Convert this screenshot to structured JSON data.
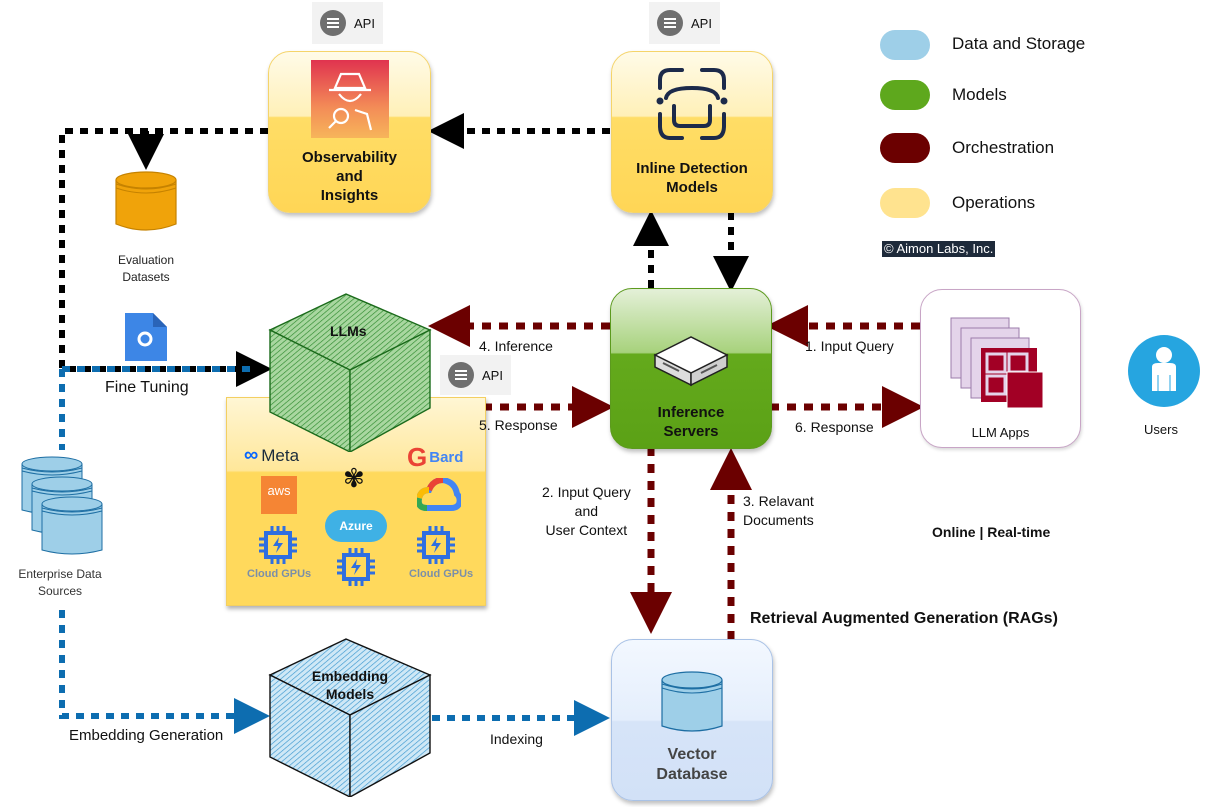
{
  "legend": {
    "items": [
      {
        "label": "Data and Storage",
        "color": "#9ecfe8"
      },
      {
        "label": "Models",
        "color": "#5ea81d"
      },
      {
        "label": "Orchestration",
        "color": "#6b0000"
      },
      {
        "label": "Operations",
        "color": "#ffe38f"
      }
    ],
    "copyright": "© Aimon Labs, Inc."
  },
  "nodes": {
    "observability": {
      "label_lines": [
        "Observability",
        "and",
        "Insights"
      ],
      "api_label": "API"
    },
    "inline_detection": {
      "label_lines": [
        "Inline Detection",
        "Models"
      ],
      "api_label": "API"
    },
    "evaluation_datasets": {
      "label_lines": [
        "Evaluation",
        "Datasets"
      ]
    },
    "llms": {
      "label": "LLMs",
      "api_label": "API"
    },
    "inference_servers": {
      "label_lines": [
        "Inference",
        "Servers"
      ]
    },
    "llm_apps": {
      "label": "LLM Apps"
    },
    "users": {
      "label": "Users"
    },
    "enterprise_data": {
      "label_lines": [
        "Enterprise Data",
        "Sources"
      ]
    },
    "embedding_models": {
      "label_lines": [
        "Embedding",
        "Models"
      ]
    },
    "vector_database": {
      "label_lines": [
        "Vector",
        "Database"
      ]
    }
  },
  "providers": {
    "meta": "Meta",
    "aws": "aws",
    "bard": "Bard",
    "azure": "Azure",
    "gpu_label": "Cloud GPUs"
  },
  "edges": {
    "fine_tuning": "Fine Tuning",
    "inference": "4. Inference",
    "response5": "5. Response",
    "input_query": "1. Input Query",
    "response6": "6. Response",
    "rag_query_lines": [
      "2. Input Query",
      "and",
      "User Context"
    ],
    "relevant_docs_lines": [
      "3. Relavant",
      "Documents"
    ],
    "embedding_generation": "Embedding Generation",
    "indexing": "Indexing"
  },
  "annotations": {
    "online": "Online | Real-time",
    "rag": "Retrieval Augmented Generation (RAGs)"
  }
}
